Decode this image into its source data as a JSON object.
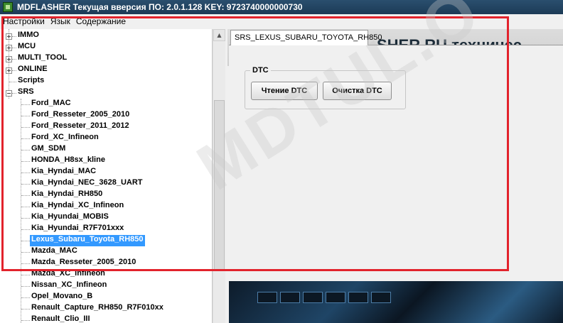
{
  "window": {
    "title": "MDFLASHER  Текущая вверсия ПО: 2.0.1.128  KEY: 9723740000000730"
  },
  "menu": [
    "Настройки",
    "Язык",
    "Содержание"
  ],
  "tree": {
    "root_items": [
      "IMMO",
      "MCU",
      "MULTI_TOOL",
      "ONLINE",
      "Scripts",
      "SRS"
    ],
    "srs_children": [
      "Ford_MAC",
      "Ford_Resseter_2005_2010",
      "Ford_Resseter_2011_2012",
      "Ford_XC_Infineon",
      "GM_SDM",
      "HONDA_H8sx_kline",
      "Kia_Hyndai_MAC",
      "Kia_Hyndai_NEC_3628_UART",
      "Kia_Hyndai_RH850",
      "Kia_Hyndai_XC_Infineon",
      "Kia_Hyundai_MOBIS",
      "Kia_Hyundai_R7F701xxx",
      "Lexus_Subaru_Toyota_RH850",
      "Mazda_MAC",
      "Mazda_Resseter_2005_2010",
      "Mazda_XC_Infineon",
      "Nissan_XC_Infineon",
      "Opel_Movano_B",
      "Renault_Capture_RH850_R7F010xx",
      "Renault_Clio_III"
    ],
    "selected": "Lexus_Subaru_Toyota_RH850"
  },
  "tab": {
    "label": "SRS_LEXUS_SUBARU_TOYOTA_RH850"
  },
  "dtc": {
    "group_label": "DTC",
    "read_button": "Чтение DTC",
    "clear_button": "Очистка DTC"
  },
  "banner": {
    "top_text": "SHER.RU техничес"
  },
  "watermark": "MDTUL.O",
  "colors": {
    "selection": "#3399ff",
    "highlight_frame": "#e2232c",
    "titlebar": "#1c3a56"
  }
}
